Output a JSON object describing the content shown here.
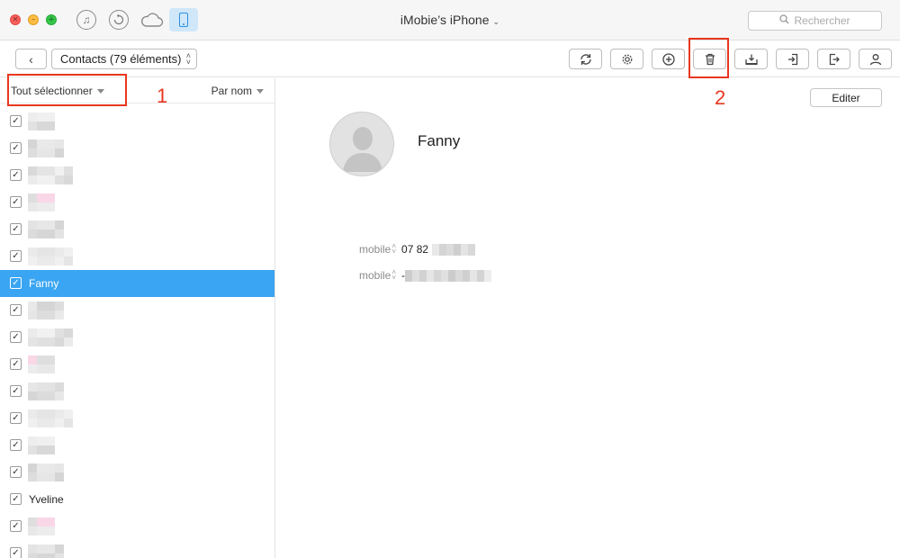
{
  "window": {
    "title": "iMobie’s iPhone",
    "title_chevron": "⌄",
    "search_placeholder": "Rechercher"
  },
  "titlebar_icons": [
    {
      "name": "music-icon"
    },
    {
      "name": "restore-icon"
    },
    {
      "name": "cloud-icon"
    },
    {
      "name": "device-icon",
      "active": true
    }
  ],
  "toolbar": {
    "back_glyph": "‹",
    "category_select": "Contacts (79 éléments)",
    "buttons": [
      {
        "name": "refresh-button",
        "icon": "refresh-icon"
      },
      {
        "name": "settings-button",
        "icon": "gear-icon"
      },
      {
        "name": "add-button",
        "icon": "plus-circle-icon"
      },
      {
        "name": "delete-button",
        "icon": "trash-icon"
      },
      {
        "name": "to-computer-button",
        "icon": "download-tray-icon"
      },
      {
        "name": "import-button",
        "icon": "import-icon"
      },
      {
        "name": "export-button",
        "icon": "export-icon"
      },
      {
        "name": "contact-card-button",
        "icon": "person-icon"
      }
    ]
  },
  "annotations": {
    "first": "1",
    "second": "2",
    "accent_color": "#e8371f"
  },
  "list": {
    "select_all_label": "Tout sélectionner",
    "sort_label": "Par nom",
    "rows": [
      {
        "name": "",
        "blurred": true,
        "checked": true
      },
      {
        "name": "",
        "blurred": true,
        "checked": true
      },
      {
        "name": "",
        "blurred": true,
        "checked": true
      },
      {
        "name": "",
        "blurred": true,
        "checked": true
      },
      {
        "name": "",
        "blurred": true,
        "checked": true
      },
      {
        "name": "",
        "blurred": true,
        "checked": true
      },
      {
        "name": "Fanny",
        "blurred": false,
        "checked": true,
        "selected": true
      },
      {
        "name": "",
        "blurred": true,
        "checked": true
      },
      {
        "name": "",
        "blurred": true,
        "checked": true
      },
      {
        "name": "",
        "blurred": true,
        "checked": true
      },
      {
        "name": "",
        "blurred": true,
        "checked": true
      },
      {
        "name": "",
        "blurred": true,
        "checked": true
      },
      {
        "name": "",
        "blurred": true,
        "checked": true
      },
      {
        "name": "",
        "blurred": true,
        "checked": true
      },
      {
        "name": "Yveline",
        "blurred": false,
        "checked": true
      },
      {
        "name": "",
        "blurred": true,
        "checked": true
      },
      {
        "name": "",
        "blurred": true,
        "checked": true
      }
    ],
    "check_glyph": "✓",
    "selected_color": "#3aa5f2"
  },
  "detail": {
    "edit_label": "Editer",
    "name": "Fanny",
    "fields": [
      {
        "label": "mobile",
        "value": "07 82",
        "redacted": true
      },
      {
        "label": "mobile",
        "value": "-",
        "redacted": true
      }
    ],
    "updown_glyph_up": "˄",
    "updown_glyph_down": "˅"
  }
}
